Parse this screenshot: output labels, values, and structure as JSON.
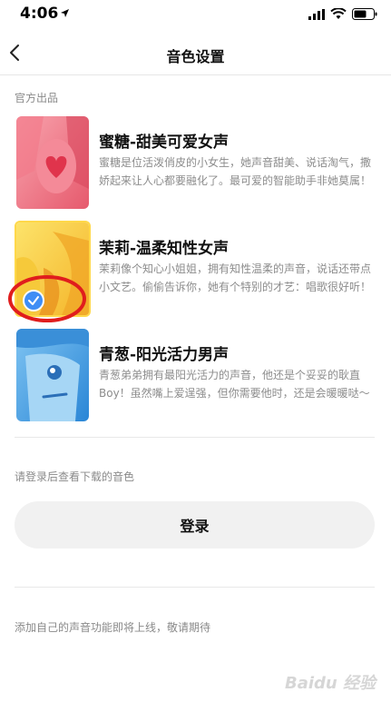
{
  "status_bar": {
    "time": "4:06"
  },
  "nav": {
    "title": "音色设置"
  },
  "sections": {
    "official_label": "官方出品",
    "downloaded_label": "请登录后查看下载的音色",
    "footer_note": "添加自己的声音功能即将上线，敬请期待"
  },
  "voices": [
    {
      "title": "蜜糖-甜美可爱女声",
      "desc": "蜜糖是位活泼俏皮的小女生，她声音甜美、说话淘气，撒娇起来让人心都要融化了。最可爱的智能助手非她莫属！",
      "selected": false
    },
    {
      "title": "茉莉-温柔知性女声",
      "desc": "茉莉像个知心小姐姐，拥有知性温柔的声音，说话还带点小文艺。偷偷告诉你，她有个特别的才艺：唱歌很好听！",
      "selected": true
    },
    {
      "title": "青葱-阳光活力男声",
      "desc": "青葱弟弟拥有最阳光活力的声音，他还是个妥妥的耿直Boy！虽然嘴上爱逞强，但你需要他时，还是会暖暖哒～",
      "selected": false
    }
  ],
  "login_button": {
    "label": "登录"
  },
  "watermark": {
    "text": "Baidu 经验"
  },
  "colors": {
    "accent_check": "#3f8ef5",
    "annotation_ring": "#e01d1d",
    "selected_border": "#ffd84a"
  }
}
